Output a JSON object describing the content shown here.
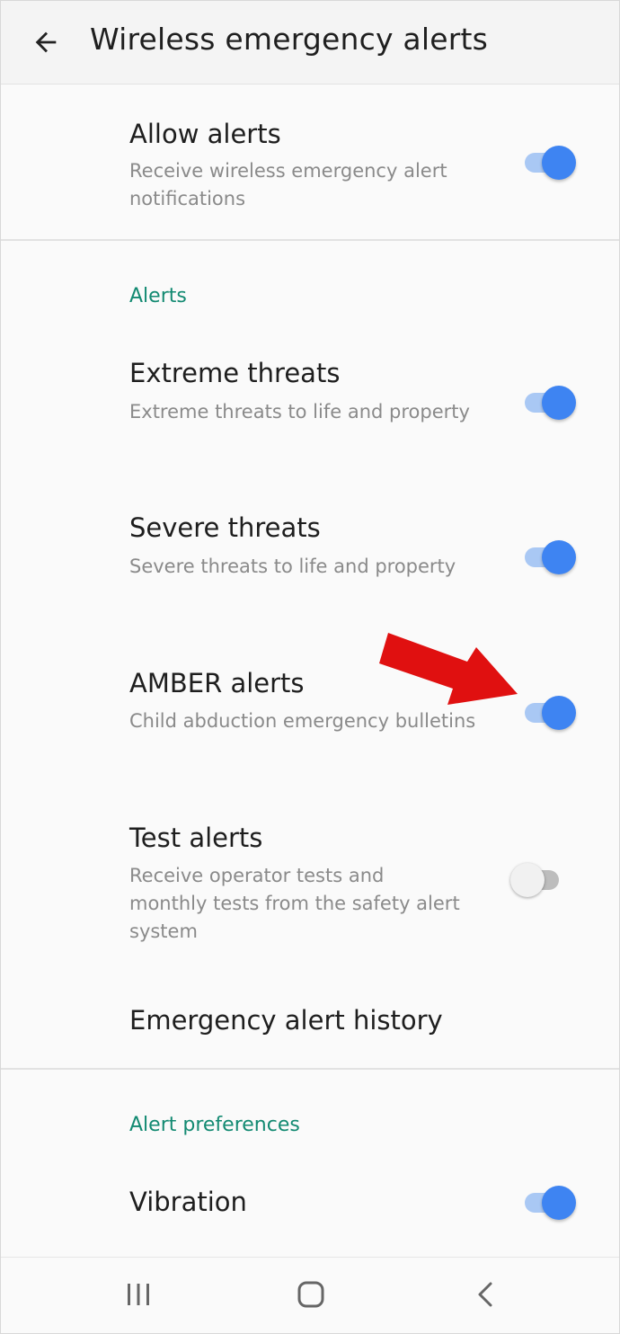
{
  "app_bar": {
    "title": "Wireless emergency alerts",
    "back_icon": "arrow-left-icon"
  },
  "allow_alerts": {
    "title": "Allow alerts",
    "summary": "Receive wireless emergency alert notifications",
    "enabled": true
  },
  "alerts_section": {
    "header": "Alerts",
    "items": [
      {
        "title": "Extreme threats",
        "summary": "Extreme threats to life and property",
        "enabled": true
      },
      {
        "title": "Severe threats",
        "summary": "Severe threats to life and property",
        "enabled": true
      },
      {
        "title": "AMBER alerts",
        "summary": "Child abduction emergency bulletins",
        "enabled": true
      },
      {
        "title": "Test alerts",
        "summary": "Receive operator tests and monthly tests from the safety alert system",
        "enabled": false
      }
    ],
    "history_label": "Emergency alert history"
  },
  "preferences_section": {
    "header": "Alert preferences",
    "items": [
      {
        "title": "Vibration",
        "enabled": true
      }
    ]
  },
  "annotation": {
    "arrow_color": "#e01010",
    "target": "AMBER alerts switch"
  },
  "colors": {
    "accent": "#3e84f2",
    "section_header": "#138a72"
  },
  "nav_bar": {
    "recents_icon": "recents-icon",
    "home_icon": "home-icon",
    "back_icon": "nav-back-icon"
  }
}
